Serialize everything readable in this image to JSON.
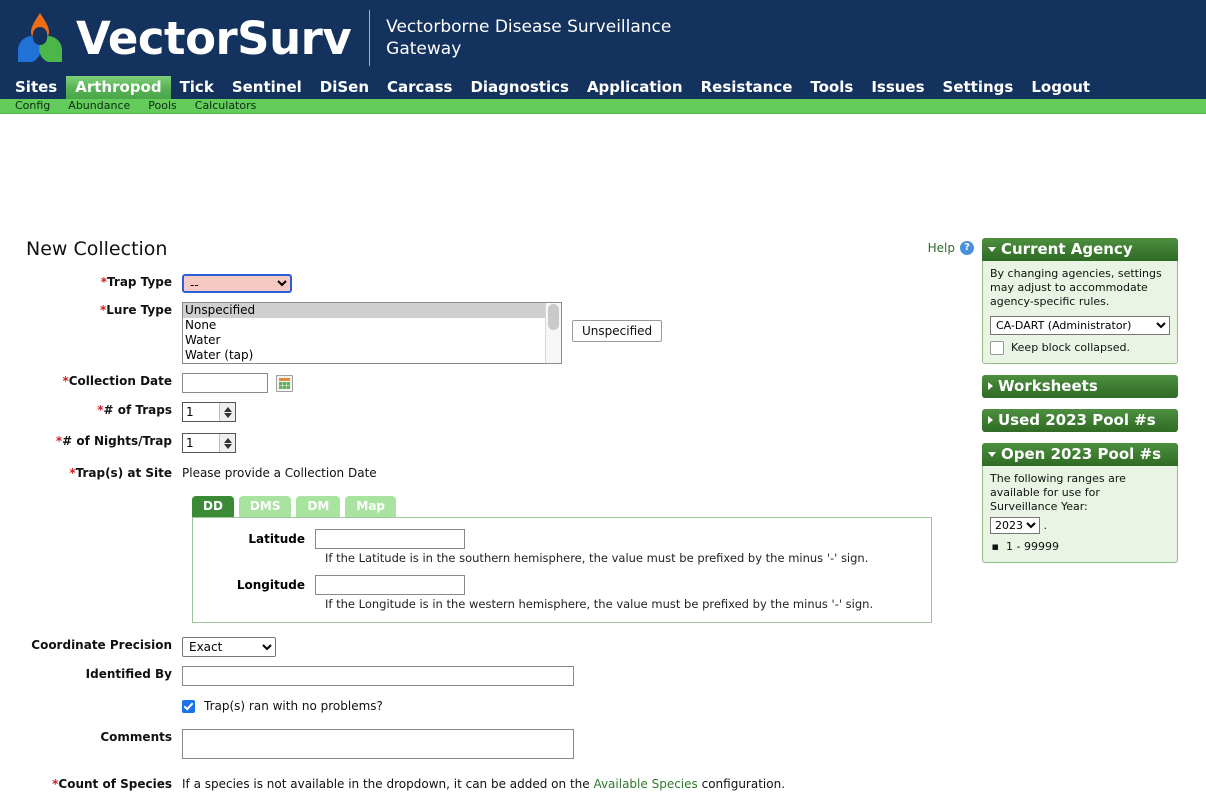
{
  "brand": {
    "name": "VectorSurv",
    "tagline": "Vectorborne Disease Surveillance Gateway",
    "logo_icon": "trefoil-logo-icon",
    "colors": {
      "header_bg": "#13325e",
      "subnav_bg": "#63cc5b",
      "active_tab": "#4aa84a",
      "accent_green": "#3b8a36",
      "required_red": "#d02020",
      "invalid_field_bg": "#f6c9c3",
      "focus_ring": "#2b5fd9"
    }
  },
  "mainnav": {
    "items": [
      {
        "label": "Sites",
        "active": false
      },
      {
        "label": "Arthropod",
        "active": true
      },
      {
        "label": "Tick",
        "active": false
      },
      {
        "label": "Sentinel",
        "active": false
      },
      {
        "label": "DiSen",
        "active": false
      },
      {
        "label": "Carcass",
        "active": false
      },
      {
        "label": "Diagnostics",
        "active": false
      },
      {
        "label": "Application",
        "active": false
      },
      {
        "label": "Resistance",
        "active": false
      },
      {
        "label": "Tools",
        "active": false
      },
      {
        "label": "Issues",
        "active": false
      },
      {
        "label": "Settings",
        "active": false
      },
      {
        "label": "Logout",
        "active": false
      }
    ]
  },
  "subnav": {
    "items": [
      {
        "label": "Config"
      },
      {
        "label": "Abundance"
      },
      {
        "label": "Pools"
      },
      {
        "label": "Calculators"
      }
    ]
  },
  "page": {
    "title": "New Collection",
    "help_label": "Help",
    "help_icon": "question-mark-icon",
    "help_badge": "?"
  },
  "form": {
    "trap_type": {
      "label": "Trap Type",
      "required": true,
      "value": "--",
      "options": [
        "--"
      ]
    },
    "lure_type": {
      "label": "Lure Type",
      "required": true,
      "options": [
        "Unspecified",
        "None",
        "Water",
        "Water (tap)"
      ],
      "selected": "Unspecified",
      "button_label": "Unspecified"
    },
    "collection_date": {
      "label": "Collection Date",
      "required": true,
      "value": "",
      "calendar_icon": "calendar-icon"
    },
    "num_traps": {
      "label": "# of Traps",
      "required": true,
      "value": "1"
    },
    "nights_per_trap": {
      "label": "# of Nights/Trap",
      "required": true,
      "value": "1"
    },
    "traps_at_site": {
      "label": "Trap(s) at Site",
      "required": true,
      "message": "Please provide a Collection Date"
    },
    "coordinates": {
      "tabs": [
        {
          "label": "DD",
          "active": true
        },
        {
          "label": "DMS",
          "active": false
        },
        {
          "label": "DM",
          "active": false
        },
        {
          "label": "Map",
          "active": false
        }
      ],
      "latitude": {
        "label": "Latitude",
        "value": "",
        "hint": "If the Latitude is in the southern hemisphere, the value must be prefixed by the minus '-' sign."
      },
      "longitude": {
        "label": "Longitude",
        "value": "",
        "hint": "If the Longitude is in the western hemisphere, the value must be prefixed by the minus '-' sign."
      }
    },
    "coordinate_precision": {
      "label": "Coordinate Precision",
      "value": "Exact",
      "options": [
        "Exact"
      ]
    },
    "identified_by": {
      "label": "Identified By",
      "value": ""
    },
    "traps_ok": {
      "label": "Trap(s) ran with no problems?",
      "checked": true
    },
    "comments": {
      "label": "Comments",
      "value": ""
    },
    "count_of_species": {
      "label": "Count of Species",
      "text_before": "If a species is not available in the dropdown, it can be added on the ",
      "link_label": "Available Species",
      "text_after": " configuration."
    }
  },
  "sidebar": {
    "current_agency": {
      "title": "Current Agency",
      "expanded": true,
      "description": "By changing agencies, settings may adjust to accommodate agency-specific rules.",
      "agency_value": "CA-DART (Administrator)",
      "agency_options": [
        "CA-DART (Administrator)"
      ],
      "keep_collapsed_label": "Keep block collapsed.",
      "keep_collapsed_checked": false
    },
    "worksheets": {
      "title": "Worksheets",
      "expanded": false
    },
    "used_pools": {
      "title": "Used 2023 Pool #s",
      "expanded": false
    },
    "open_pools": {
      "title": "Open 2023 Pool #s",
      "expanded": true,
      "description": "The following ranges are available for use for Surveillance Year:",
      "year_value": "2023",
      "year_options": [
        "2023"
      ],
      "trailing_dot": ".",
      "ranges": [
        "1 - 99999"
      ]
    }
  }
}
